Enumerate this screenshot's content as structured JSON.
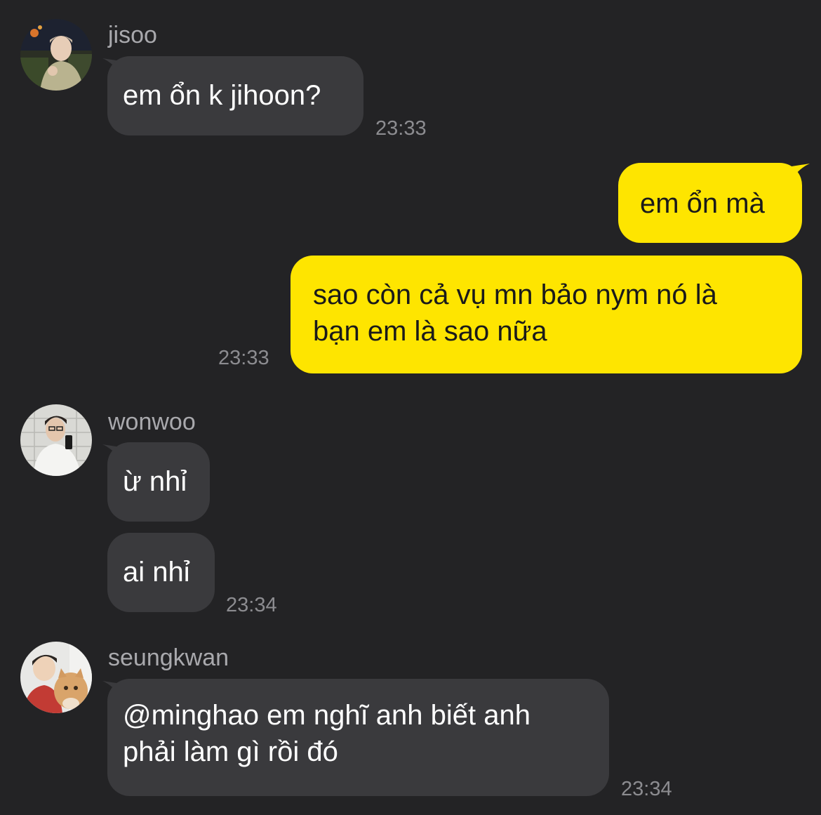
{
  "colors": {
    "background": "#232325",
    "incoming_bubble": "#3a3a3d",
    "outgoing_bubble": "#fee500",
    "name_text": "#a9a9ad",
    "timestamp_text": "#8c8c90"
  },
  "chat": {
    "groups": [
      {
        "sender": "jisoo",
        "avatar_icon": "jisoo-avatar",
        "messages": [
          "em ổn k jihoon?"
        ],
        "time": "23:33"
      },
      {
        "sender": "me",
        "outgoing": true,
        "messages": [
          "em ổn mà",
          "sao còn cả vụ mn bảo nym nó là",
          "bạn em là sao nữa"
        ],
        "time": "23:33"
      },
      {
        "sender": "wonwoo",
        "avatar_icon": "wonwoo-avatar",
        "messages": [
          "ừ nhỉ",
          "ai nhỉ"
        ],
        "time": "23:34"
      },
      {
        "sender": "seungkwan",
        "avatar_icon": "seungkwan-avatar",
        "messages": [
          "@minghao em nghĩ anh biết anh",
          "phải làm gì rồi đó"
        ],
        "time": "23:34"
      }
    ]
  }
}
